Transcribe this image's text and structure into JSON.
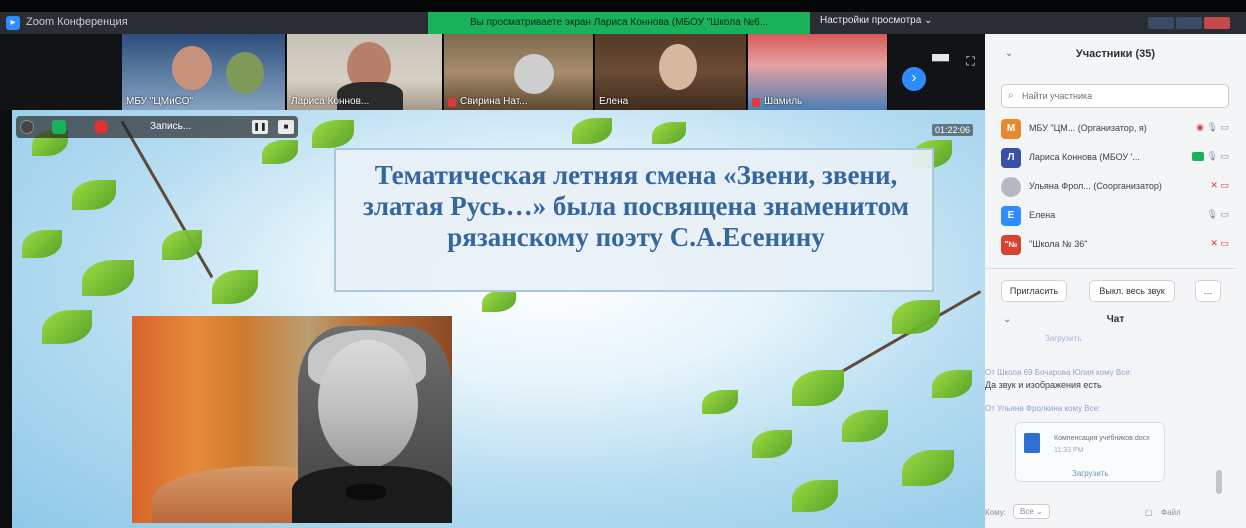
{
  "window": {
    "title": "Zoom Конференция",
    "view_settings": "Настройки просмотра ⌄",
    "share_banner": "Вы просматриваете экран Лариса Коннова (МБОУ \"Школа №6..."
  },
  "thumbnails": [
    {
      "name": "МБУ \"ЦМиСО\""
    },
    {
      "name": "Лариса Коннов..."
    },
    {
      "name": "Свирина Нат..."
    },
    {
      "name": "Елена"
    },
    {
      "name": "Шамиль"
    }
  ],
  "share_toolbar": {
    "record_label": "Запись...",
    "timer": "01:22:06"
  },
  "slide": {
    "title": "Тематическая летняя смена «Звени, звени, златая Русь…» была посвящена знаменитом рязанскому поэту С.А.Есенину"
  },
  "participants": {
    "header": "Участники (35)",
    "search_placeholder": "Найти участника",
    "list": [
      {
        "initial": "М",
        "color": "#e8892d",
        "name": "МБУ \"ЦМ... (Организатор, я)"
      },
      {
        "initial": "Л",
        "color": "#3b4fa8",
        "name": "Лариса Коннова (МБОУ '..."
      },
      {
        "initial": "",
        "color": "#b5bac2",
        "name": "Ульяна Фрол... (Соорганизатор)"
      },
      {
        "initial": "Е",
        "color": "#2d8cff",
        "name": "Елена"
      },
      {
        "initial": "\"№",
        "color": "#d8432f",
        "name": "\"Школа № 36\""
      }
    ],
    "invite_label": "Пригласить",
    "mute_all_label": "Выкл. весь звук"
  },
  "chat": {
    "header": "Чат",
    "partial": "Загрузить",
    "messages": [
      {
        "from": "От Школа 69 Бочарова Юлия кому Все:",
        "text": "Да звук и изображения есть"
      },
      {
        "from": "От Ульяна Фролкина кому Все:",
        "text": ""
      }
    ],
    "file": {
      "name": "Компенсация учебников.docx",
      "time": "11:33 РМ",
      "download": "Загрузить"
    },
    "to_label": "Кому:",
    "to_value": "Все",
    "file_label": "Файл"
  }
}
